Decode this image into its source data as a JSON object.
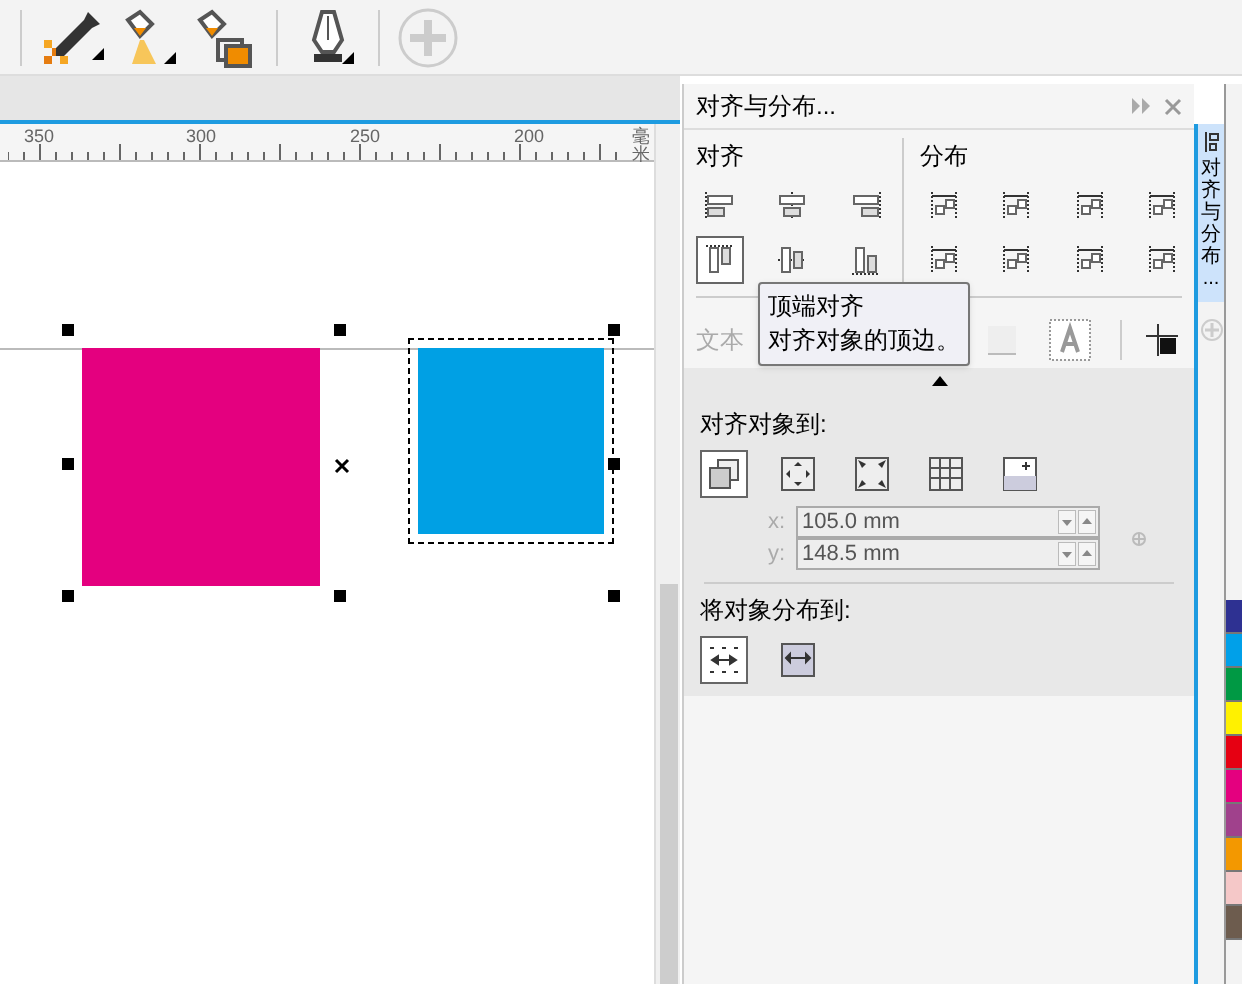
{
  "ruler": {
    "labels": [
      "350",
      "300",
      "250",
      "200",
      "毫米"
    ]
  },
  "canvas": {
    "shapes": [
      {
        "color": "#e4007f",
        "selected": false
      },
      {
        "color": "#00a0e4",
        "selected": true
      }
    ]
  },
  "panel": {
    "title": "对齐与分布...",
    "align": {
      "heading": "对齐",
      "buttons": [
        {
          "selected": false
        },
        {
          "selected": false
        },
        {
          "selected": false
        },
        {
          "selected": true
        },
        {
          "selected": false
        },
        {
          "selected": false
        }
      ]
    },
    "distribute": {
      "heading": "分布",
      "buttons": [
        {
          "selected": false
        },
        {
          "selected": false
        },
        {
          "selected": false
        },
        {
          "selected": false
        },
        {
          "selected": false
        },
        {
          "selected": false
        },
        {
          "selected": false
        },
        {
          "selected": false
        }
      ]
    },
    "text_label": "文本",
    "tooltip": {
      "title": "顶端对齐",
      "text": "对齐对象的顶边。"
    },
    "align_to": {
      "heading": "对齐对象到:",
      "options": [
        {
          "selected": true
        },
        {
          "selected": false
        },
        {
          "selected": false
        },
        {
          "selected": false
        },
        {
          "selected": false
        }
      ],
      "x_label": "x:",
      "x_value": "105.0 mm",
      "y_label": "y:",
      "y_value": "148.5 mm"
    },
    "distribute_to": {
      "heading": "将对象分布到:",
      "options": [
        {
          "selected": true
        },
        {
          "selected": false
        }
      ]
    }
  },
  "side_tab": {
    "label": "对齐与分布..."
  },
  "palette": {
    "swatches": [
      {
        "color": "#2e3192"
      },
      {
        "color": "#00a0e9"
      },
      {
        "color": "#009944"
      },
      {
        "color": "#fff100"
      },
      {
        "color": "#e60012"
      },
      {
        "color": "#e4007f"
      },
      {
        "color": "#a0418c"
      },
      {
        "color": "#f39800"
      },
      {
        "color": "#f5c8c8"
      },
      {
        "color": "#6d5c4e"
      }
    ]
  }
}
